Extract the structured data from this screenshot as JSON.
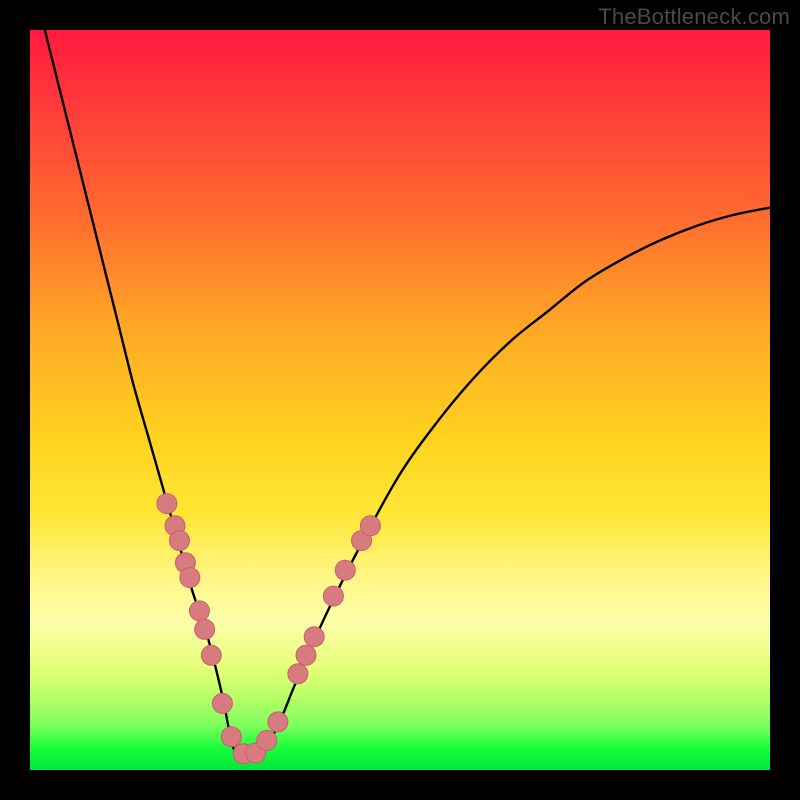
{
  "watermark": "TheBottleneck.com",
  "colors": {
    "frame": "#000000",
    "curve": "#000000",
    "marker_fill": "#d87b80",
    "marker_stroke": "#c86066",
    "gradient_top": "#ff1a3f",
    "gradient_bottom": "#00e63b"
  },
  "chart_data": {
    "type": "line",
    "title": "",
    "xlabel": "",
    "ylabel": "",
    "xlim": [
      0,
      100
    ],
    "ylim": [
      0,
      100
    ],
    "series": [
      {
        "name": "bottleneck-curve",
        "x": [
          2,
          4,
          6,
          8,
          10,
          12,
          14,
          16,
          18,
          20,
          22,
          24,
          26,
          27,
          28,
          30,
          33,
          36,
          40,
          45,
          50,
          55,
          60,
          65,
          70,
          75,
          80,
          85,
          90,
          95,
          100
        ],
        "y": [
          100,
          92,
          84,
          76,
          68,
          60,
          52,
          45,
          38,
          31,
          24,
          18,
          10,
          5,
          2,
          2,
          5,
          12,
          21,
          31,
          40,
          47,
          53,
          58,
          62,
          66,
          69,
          71.5,
          73.5,
          75,
          76
        ]
      }
    ],
    "markers": [
      {
        "x": 18.5,
        "y": 36
      },
      {
        "x": 19.6,
        "y": 33
      },
      {
        "x": 20.2,
        "y": 31
      },
      {
        "x": 21.0,
        "y": 28
      },
      {
        "x": 21.6,
        "y": 26
      },
      {
        "x": 22.9,
        "y": 21.5
      },
      {
        "x": 23.6,
        "y": 19
      },
      {
        "x": 24.5,
        "y": 15.5
      },
      {
        "x": 26.0,
        "y": 9
      },
      {
        "x": 27.2,
        "y": 4.5
      },
      {
        "x": 28.8,
        "y": 2.2
      },
      {
        "x": 30.5,
        "y": 2.3
      },
      {
        "x": 32.0,
        "y": 4
      },
      {
        "x": 33.5,
        "y": 6.5
      },
      {
        "x": 36.2,
        "y": 13
      },
      {
        "x": 37.3,
        "y": 15.5
      },
      {
        "x": 38.4,
        "y": 18
      },
      {
        "x": 41.0,
        "y": 23.5
      },
      {
        "x": 42.6,
        "y": 27
      },
      {
        "x": 44.8,
        "y": 31
      },
      {
        "x": 46.0,
        "y": 33
      }
    ],
    "marker_radius_px": 10
  }
}
